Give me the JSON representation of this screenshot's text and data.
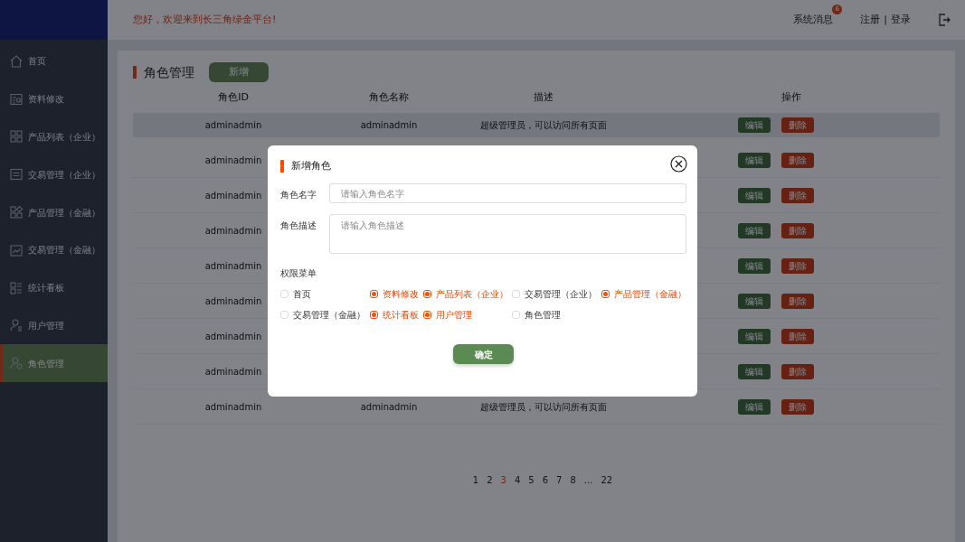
{
  "header": {
    "greeting": "您好，欢迎来到长三角绿金平台!",
    "messages": {
      "label": "系统消息",
      "count": "6"
    },
    "register": "注册",
    "separator": "|",
    "login": "登录"
  },
  "sidebar": {
    "items": [
      {
        "label": "首页",
        "selected": false
      },
      {
        "label": "资料修改",
        "selected": false
      },
      {
        "label": "产品列表（企业）",
        "selected": false
      },
      {
        "label": "交易管理（企业）",
        "selected": false
      },
      {
        "label": "产品管理（金融）",
        "selected": false
      },
      {
        "label": "交易管理（金融）",
        "selected": false
      },
      {
        "label": "统计看板",
        "selected": false
      },
      {
        "label": "用户管理",
        "selected": false
      },
      {
        "label": "角色管理",
        "selected": true
      }
    ]
  },
  "page": {
    "title": "角色管理",
    "add_button": "新增"
  },
  "table": {
    "columns": [
      "角色ID",
      "角色名称",
      "描述",
      "操作"
    ],
    "rows": [
      {
        "id": "adminadmin",
        "name": "adminadmin",
        "description": "超级管理员，可以访问所有页面",
        "actions": [
          "编辑",
          "删除"
        ],
        "highlighted": true
      },
      {
        "id": "adminadmin",
        "actions": [
          "编辑",
          "删除"
        ],
        "highlighted": false
      },
      {
        "id": "adminadmin",
        "actions": [
          "编辑",
          "删除"
        ],
        "highlighted": false
      },
      {
        "id": "adminadmin",
        "actions": [
          "编辑",
          "删除"
        ],
        "highlighted": false
      },
      {
        "id": "adminadmin",
        "actions": [
          "编辑",
          "删除"
        ],
        "highlighted": false
      },
      {
        "id": "adminadmin",
        "actions": [
          "编辑",
          "删除"
        ],
        "highlighted": false
      },
      {
        "id": "adminadmin",
        "actions": [
          "编辑",
          "删除"
        ],
        "highlighted": false
      },
      {
        "id": "adminadmin",
        "actions": [
          "编辑",
          "删除"
        ],
        "highlighted": false
      },
      {
        "id": "adminadmin",
        "name": "adminadmin",
        "description": "超级管理员，可以访问所有页面",
        "actions": [
          "编辑",
          "删除"
        ],
        "highlighted": false
      }
    ]
  },
  "pagination": [
    {
      "label": "1",
      "selected": false
    },
    {
      "label": "2",
      "selected": false
    },
    {
      "label": "3",
      "selected": true
    },
    {
      "label": "4",
      "selected": false
    },
    {
      "label": "5",
      "selected": false
    },
    {
      "label": "6",
      "selected": false
    },
    {
      "label": "7",
      "selected": false
    },
    {
      "label": "8",
      "selected": false
    },
    {
      "label": "...",
      "selected": false
    },
    {
      "label": "22",
      "selected": false
    }
  ],
  "dialog": {
    "title": "新增角色",
    "fields": [
      {
        "label": "角色名字",
        "placeholder": "请输入角色名字",
        "kind": "input"
      },
      {
        "label": "角色描述",
        "placeholder": "请输入角色描述",
        "kind": "textarea"
      }
    ],
    "permissions_label": "权限菜单",
    "permissions": [
      {
        "label": "首页",
        "checked": false
      },
      {
        "label": "资料修改",
        "checked": true
      },
      {
        "label": "产品列表（企业）",
        "checked": true
      },
      {
        "label": "交易管理（企业）",
        "checked": false
      },
      {
        "label": "产品管理（金融）",
        "checked": true
      },
      {
        "label": "交易管理（金融）",
        "checked": false
      },
      {
        "label": "统计看板",
        "checked": true
      },
      {
        "label": "用户管理",
        "checked": true
      },
      {
        "label": "角色管理",
        "checked": false
      }
    ],
    "confirm": "确定"
  }
}
